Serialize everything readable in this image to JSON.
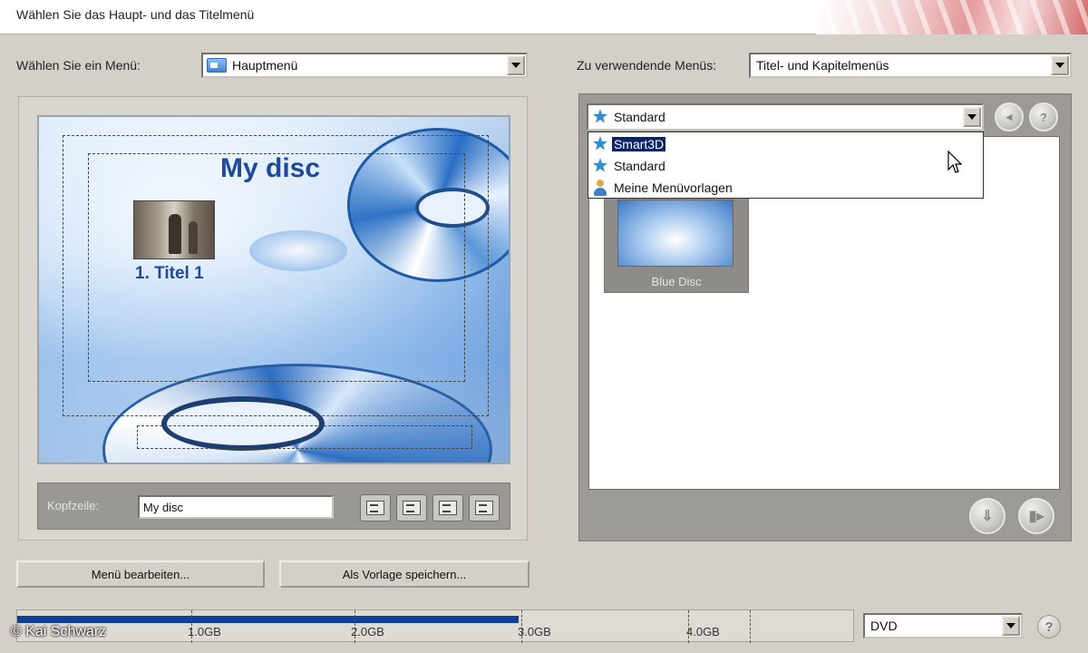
{
  "header": {
    "title": "Wählen Sie das Haupt- und das Titelmenü"
  },
  "menu_select": {
    "label": "Wählen Sie ein Menü:",
    "value": "Hauptmenü"
  },
  "use_menu": {
    "label": "Zu verwendende Menüs:",
    "value": "Titel- und Kapitelmenüs"
  },
  "preview": {
    "title": "My disc",
    "item_label": "1. Titel 1"
  },
  "header_row": {
    "label": "Kopfzeile:",
    "value": "My disc"
  },
  "buttons": {
    "edit_menu": "Menü bearbeiten...",
    "save_template": "Als Vorlage speichern..."
  },
  "template_combo": {
    "value": "Standard",
    "options": [
      "Smart3D",
      "Standard",
      "Meine Menüvorlagen"
    ],
    "selected_index": 0
  },
  "templates": [
    {
      "label": "Blue Disc"
    }
  ],
  "capacity": {
    "labels": [
      "1.0GB",
      "2.0GB",
      "3.0GB",
      "4.0GB"
    ],
    "used_fraction": 0.6
  },
  "disc_type": {
    "value": "DVD"
  },
  "help": {
    "label": "?"
  },
  "watermark": "© Kai Schwarz",
  "colors": {
    "selection": "#0a246a",
    "capacity_fill": "#123f96",
    "panel": "#9c9a95"
  }
}
